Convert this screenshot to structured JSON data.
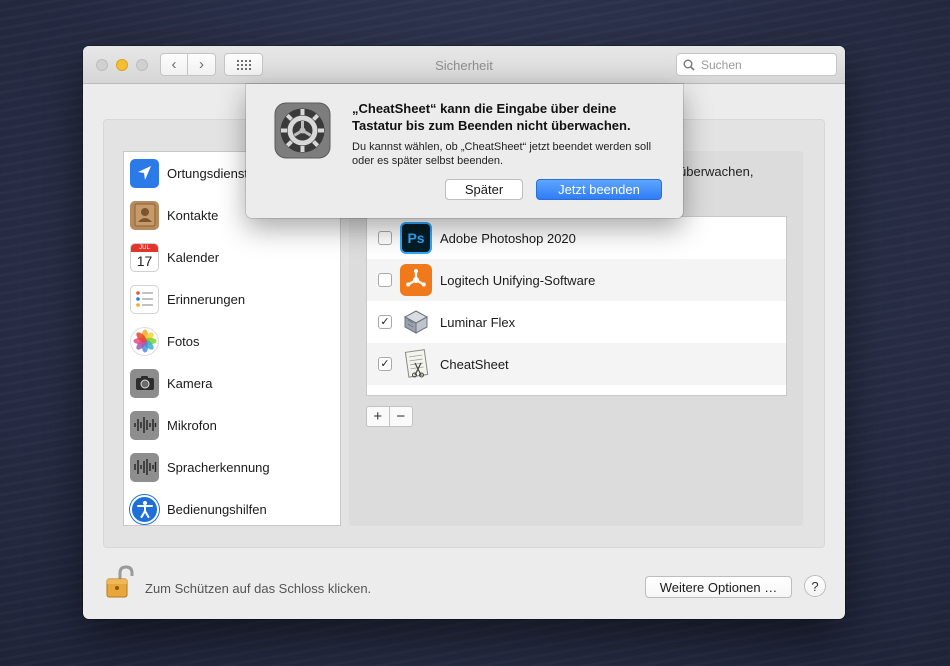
{
  "window": {
    "title": "Sicherheit",
    "search_placeholder": "Suchen"
  },
  "sidebar": {
    "items": [
      {
        "label": "Ortungsdienste",
        "icon": "location-arrow-icon"
      },
      {
        "label": "Kontakte",
        "icon": "contacts-book-icon"
      },
      {
        "label": "Kalender",
        "icon": "calendar-icon",
        "day": "17",
        "month": "JUL"
      },
      {
        "label": "Erinnerungen",
        "icon": "reminders-list-icon"
      },
      {
        "label": "Fotos",
        "icon": "photos-flower-icon"
      },
      {
        "label": "Kamera",
        "icon": "camera-icon"
      },
      {
        "label": "Mikrofon",
        "icon": "microphone-waveform-icon"
      },
      {
        "label": "Spracherkennung",
        "icon": "speech-waveform-icon"
      },
      {
        "label": "Bedienungshilfen",
        "icon": "accessibility-icon"
      }
    ]
  },
  "main": {
    "info_tail": "überwachen,",
    "apps": [
      {
        "name": "Adobe Photoshop 2020",
        "checked": false,
        "icon": "photoshop-icon",
        "icon_text": "Ps"
      },
      {
        "name": "Logitech Unifying-Software",
        "checked": false,
        "icon": "logitech-unifying-icon"
      },
      {
        "name": "Luminar Flex",
        "checked": true,
        "icon": "luminar-flex-icon"
      },
      {
        "name": "CheatSheet",
        "checked": true,
        "icon": "cheatsheet-icon"
      }
    ],
    "add_label": "+",
    "remove_label": "−"
  },
  "footer": {
    "lock_text": "Zum Schützen auf das Schloss klicken.",
    "more_options_label": "Weitere Optionen …",
    "help_label": "?"
  },
  "alert": {
    "title": "„CheatSheet“ kann die Eingabe über deine Tastatur bis zum Beenden nicht überwachen.",
    "message": "Du kannst wählen, ob „CheatSheet“ jetzt beendet werden soll oder es später selbst beenden.",
    "later_label": "Später",
    "quit_now_label": "Jetzt beenden"
  },
  "colors": {
    "accent": "#2f7cf6",
    "traffic_minimize": "#f5bf2f"
  }
}
